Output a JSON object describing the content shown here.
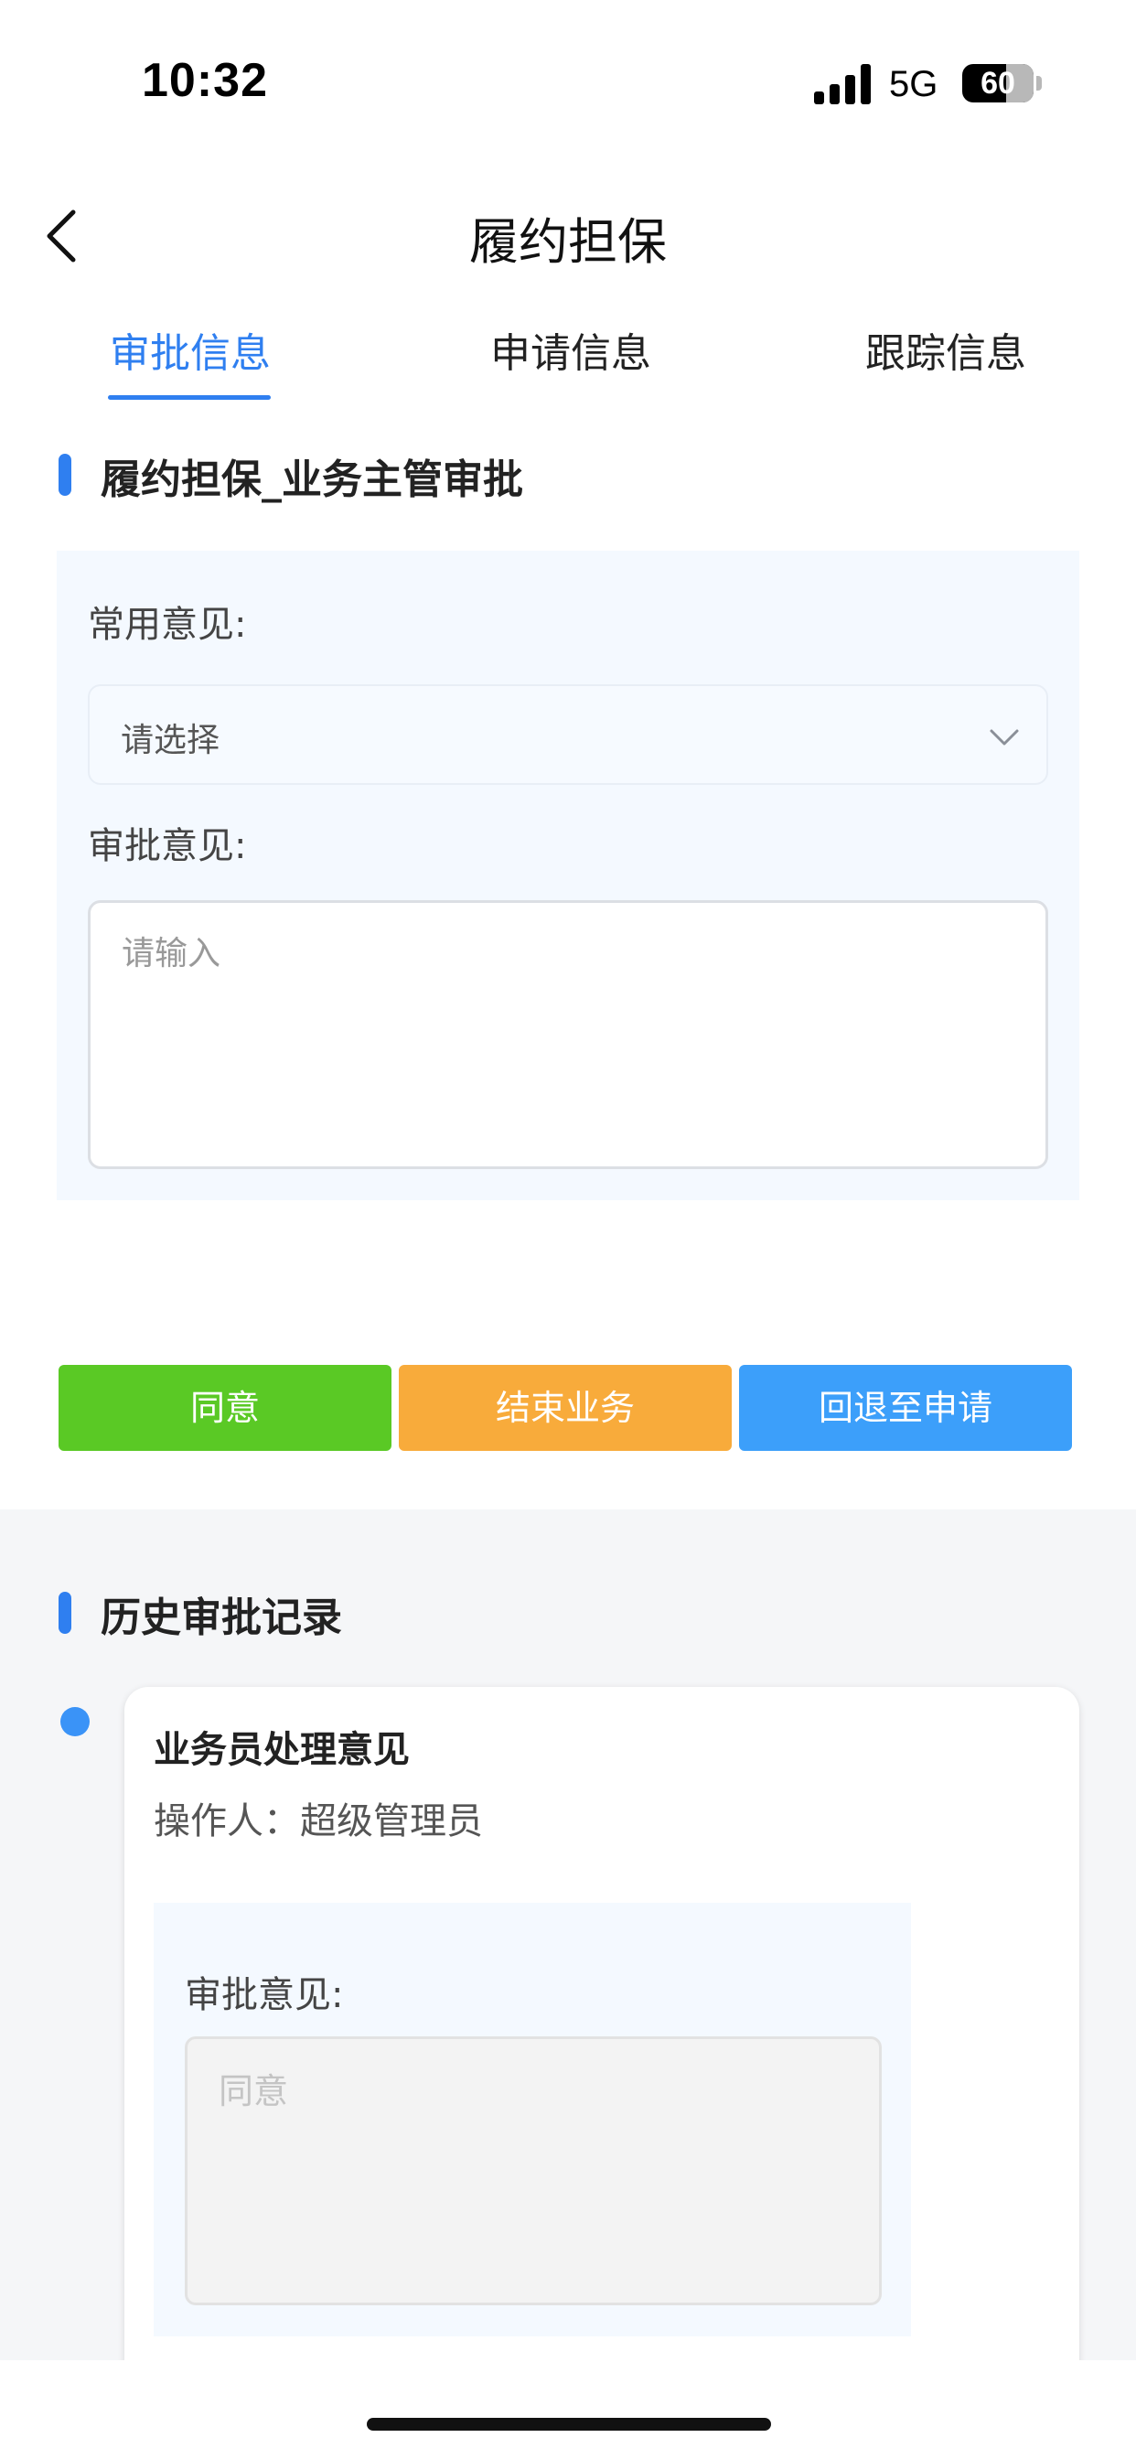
{
  "status_bar": {
    "time": "10:32",
    "network": "5G",
    "battery": "60"
  },
  "nav": {
    "back_icon": "chevron-left-icon",
    "title": "履约担保"
  },
  "tabs": [
    {
      "label": "审批信息",
      "active": true
    },
    {
      "label": "申请信息",
      "active": false
    },
    {
      "label": "跟踪信息",
      "active": false
    }
  ],
  "approval": {
    "section_title": "履约担保_业务主管审批",
    "common_opinion_label": "常用意见:",
    "common_opinion_placeholder": "请选择",
    "approval_opinion_label": "审批意见:",
    "approval_opinion_placeholder": "请输入"
  },
  "actions": {
    "agree": "同意",
    "end_business": "结束业务",
    "return_to_apply": "回退至申请"
  },
  "history": {
    "section_title": "历史审批记录",
    "records": [
      {
        "title": "业务员处理意见",
        "operator": "操作人：超级管理员",
        "opinion_label": "审批意见:",
        "opinion_value": "同意"
      }
    ]
  },
  "colors": {
    "accent": "#2f7ff0",
    "agree": "#5ac925",
    "end": "#f8ab3b",
    "return": "#3c9ffa"
  }
}
